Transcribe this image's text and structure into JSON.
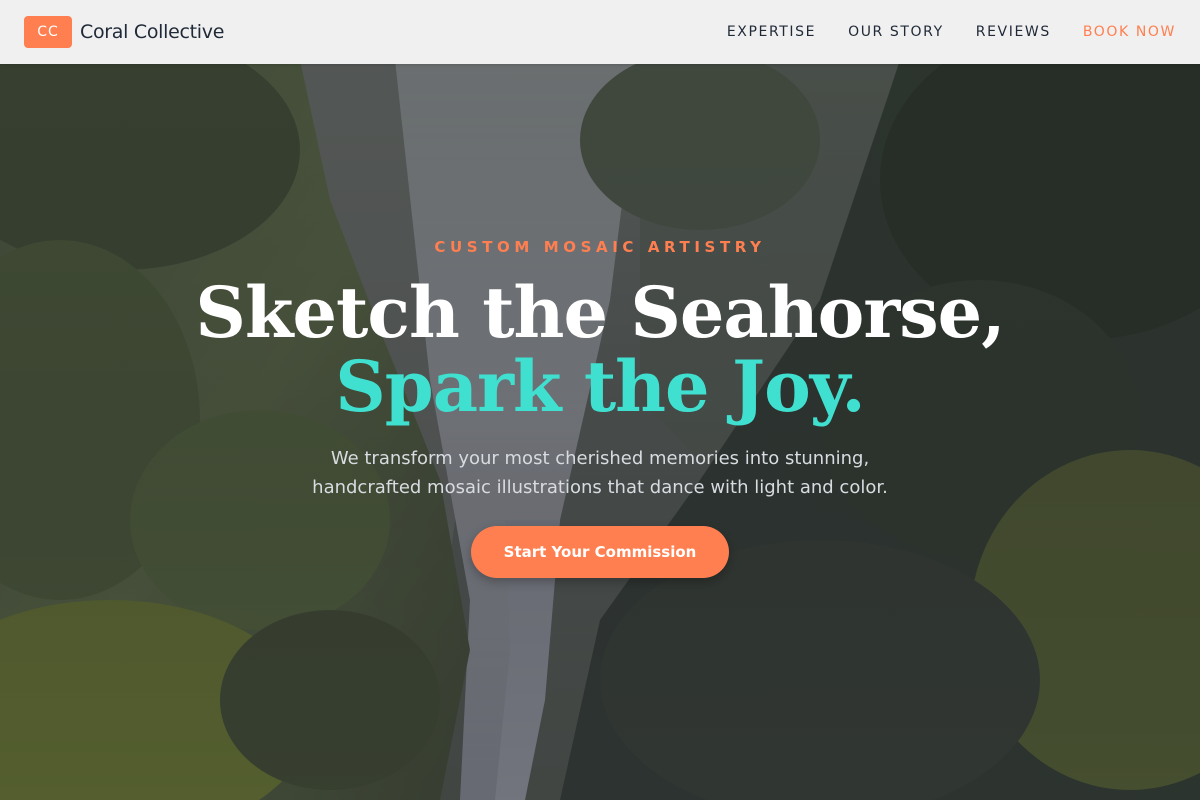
{
  "brand": {
    "logo_text": "CC",
    "name": "Coral Collective"
  },
  "nav": {
    "items": [
      {
        "label": "EXPERTISE"
      },
      {
        "label": "OUR STORY"
      },
      {
        "label": "REVIEWS"
      },
      {
        "label": "BOOK NOW",
        "accent": true
      }
    ]
  },
  "hero": {
    "eyebrow": "CUSTOM MOSAIC ARTISTRY",
    "headline_line1": "Sketch the Seahorse,",
    "headline_line2": "Spark the Joy.",
    "subtitle_line1": "We transform your most cherished memories into stunning,",
    "subtitle_line2": "handcrafted mosaic illustrations that dance with light and color.",
    "cta_label": "Start Your Commission",
    "background": "waterfall-gorge-painting"
  },
  "colors": {
    "accent": "#ff7f50",
    "teal": "#40e0d0",
    "navbar_bg": "#f0f0f0",
    "text_dark": "#1f2937"
  }
}
